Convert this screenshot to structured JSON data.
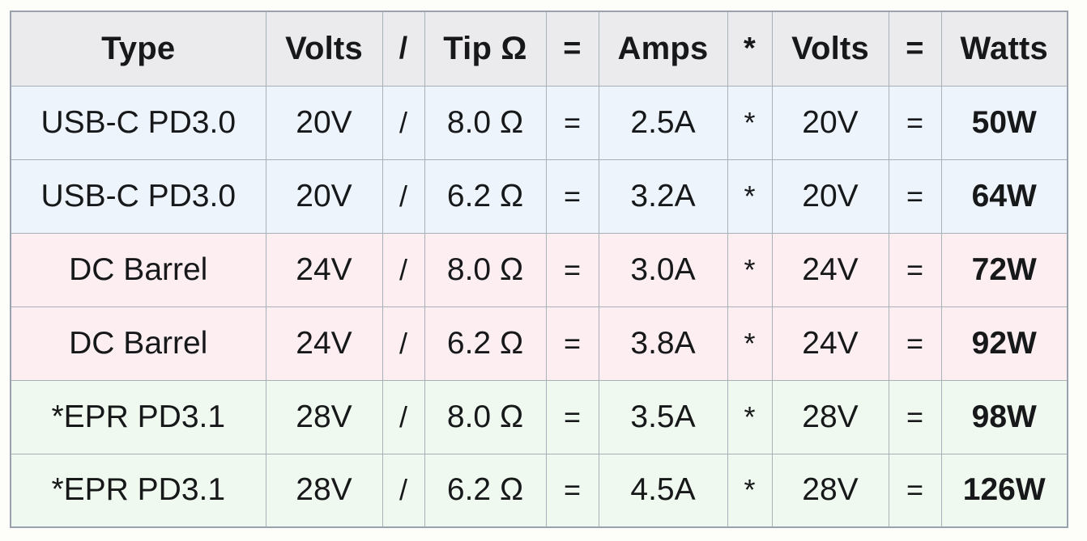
{
  "table": {
    "columns": [
      {
        "key": "type",
        "label": "Type"
      },
      {
        "key": "volts1",
        "label": "Volts"
      },
      {
        "key": "div",
        "label": "/"
      },
      {
        "key": "tip",
        "label": "Tip Ω"
      },
      {
        "key": "eq1",
        "label": "="
      },
      {
        "key": "amps",
        "label": "Amps"
      },
      {
        "key": "mul",
        "label": "*"
      },
      {
        "key": "volts2",
        "label": "Volts"
      },
      {
        "key": "eq2",
        "label": "="
      },
      {
        "key": "watts",
        "label": "Watts"
      }
    ],
    "rows": [
      {
        "group": "usbc",
        "type": "USB-C PD3.0",
        "volts1": "20V",
        "div": "/",
        "tip": "8.0 Ω",
        "eq1": "=",
        "amps": "2.5A",
        "mul": "*",
        "volts2": "20V",
        "eq2": "=",
        "watts": "50W"
      },
      {
        "group": "usbc",
        "type": "USB-C PD3.0",
        "volts1": "20V",
        "div": "/",
        "tip": "6.2 Ω",
        "eq1": "=",
        "amps": "3.2A",
        "mul": "*",
        "volts2": "20V",
        "eq2": "=",
        "watts": "64W"
      },
      {
        "group": "dc",
        "type": "DC Barrel",
        "volts1": "24V",
        "div": "/",
        "tip": "8.0 Ω",
        "eq1": "=",
        "amps": "3.0A",
        "mul": "*",
        "volts2": "24V",
        "eq2": "=",
        "watts": "72W"
      },
      {
        "group": "dc",
        "type": "DC Barrel",
        "volts1": "24V",
        "div": "/",
        "tip": "6.2 Ω",
        "eq1": "=",
        "amps": "3.8A",
        "mul": "*",
        "volts2": "24V",
        "eq2": "=",
        "watts": "92W"
      },
      {
        "group": "epr",
        "type": "*EPR PD3.1",
        "volts1": "28V",
        "div": "/",
        "tip": "8.0 Ω",
        "eq1": "=",
        "amps": "3.5A",
        "mul": "*",
        "volts2": "28V",
        "eq2": "=",
        "watts": "98W"
      },
      {
        "group": "epr",
        "type": "*EPR PD3.1",
        "volts1": "28V",
        "div": "/",
        "tip": "6.2 Ω",
        "eq1": "=",
        "amps": "4.5A",
        "mul": "*",
        "volts2": "28V",
        "eq2": "=",
        "watts": "126W"
      }
    ]
  },
  "colors": {
    "page_background": "#fdfdfa",
    "header_background": "#ebebee",
    "row_usbc": "#eef4fc",
    "row_dc": "#fdeef1",
    "row_epr": "#f0f9ef",
    "border": "#a8b0b8",
    "outer_border": "#9aa3ad",
    "text": "#17181a"
  }
}
